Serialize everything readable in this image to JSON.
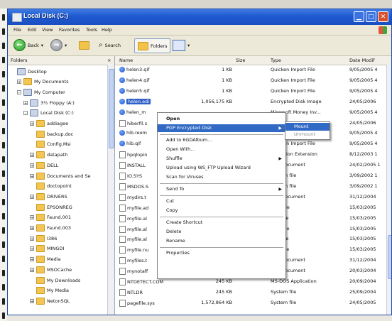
{
  "window": {
    "title": "Local Disk (C:)"
  },
  "menu": [
    "File",
    "Edit",
    "View",
    "Favorites",
    "Tools",
    "Help"
  ],
  "toolbar": {
    "back_label": "Back",
    "search_label": "Search",
    "folders_label": "Folders"
  },
  "folders_pane": {
    "header": "Folders",
    "close": "×",
    "tree": [
      {
        "label": "Desktop",
        "indent": 0,
        "pm": "",
        "kind": "desk"
      },
      {
        "label": "My Documents",
        "indent": 1,
        "pm": "+",
        "kind": "folder"
      },
      {
        "label": "My Computer",
        "indent": 1,
        "pm": "-",
        "kind": "comp"
      },
      {
        "label": "3½ Floppy (A:)",
        "indent": 2,
        "pm": "+",
        "kind": "drive"
      },
      {
        "label": "Local Disk (C:)",
        "indent": 2,
        "pm": "-",
        "kind": "drive"
      },
      {
        "label": "addiagee",
        "indent": 3,
        "pm": "+",
        "kind": "folder"
      },
      {
        "label": "backup.doc",
        "indent": 3,
        "pm": "",
        "kind": "folder"
      },
      {
        "label": "Config.Msi",
        "indent": 3,
        "pm": "",
        "kind": "folder"
      },
      {
        "label": "datapath",
        "indent": 3,
        "pm": "+",
        "kind": "folder"
      },
      {
        "label": "DELL",
        "indent": 3,
        "pm": "+",
        "kind": "folder"
      },
      {
        "label": "Documents and Se",
        "indent": 3,
        "pm": "+",
        "kind": "folder"
      },
      {
        "label": "doctopoint",
        "indent": 3,
        "pm": "",
        "kind": "folder"
      },
      {
        "label": "DRIVERS",
        "indent": 3,
        "pm": "+",
        "kind": "folder"
      },
      {
        "label": "EPSONREG",
        "indent": 3,
        "pm": "",
        "kind": "folder"
      },
      {
        "label": "Faund.001",
        "indent": 3,
        "pm": "+",
        "kind": "folder"
      },
      {
        "label": "Faund.003",
        "indent": 3,
        "pm": "+",
        "kind": "folder"
      },
      {
        "label": "I386",
        "indent": 3,
        "pm": "+",
        "kind": "folder"
      },
      {
        "label": "MINGDI",
        "indent": 3,
        "pm": "+",
        "kind": "folder"
      },
      {
        "label": "Media",
        "indent": 3,
        "pm": "+",
        "kind": "folder"
      },
      {
        "label": "MSOCache",
        "indent": 3,
        "pm": "+",
        "kind": "folder"
      },
      {
        "label": "My Downloads",
        "indent": 3,
        "pm": "",
        "kind": "folder"
      },
      {
        "label": "My Media",
        "indent": 3,
        "pm": "",
        "kind": "folder"
      },
      {
        "label": "NetonSQL",
        "indent": 3,
        "pm": "+",
        "kind": "folder"
      }
    ]
  },
  "files": {
    "headers": {
      "name": "Name",
      "size": "Size",
      "type": "Type",
      "date": "Date Modif"
    },
    "rows": [
      {
        "name": "helen3.qif",
        "size": "1 KB",
        "type": "Quicken Import File",
        "date": "9/05/2005 4",
        "icon": "qt",
        "sel": false
      },
      {
        "name": "helen4.qif",
        "size": "1 KB",
        "type": "Quicken Import File",
        "date": "9/05/2005 4",
        "icon": "qt",
        "sel": false
      },
      {
        "name": "helen5.qif",
        "size": "1 KB",
        "type": "Quicken Import File",
        "date": "9/05/2005 4",
        "icon": "qt",
        "sel": false
      },
      {
        "name": "helen.edi",
        "size": "1,056,175 KB",
        "type": "Encrypted Disk Image",
        "date": "24/05/2006",
        "icon": "qt",
        "sel": true
      },
      {
        "name": "helen_m",
        "size": "",
        "type": "Microsoft Money Inv...",
        "date": "9/05/2005 4",
        "icon": "qt",
        "sel": false
      },
      {
        "name": "hiberfil.s",
        "size": "",
        "type": "",
        "date": "24/05/2006",
        "icon": "doc",
        "sel": false
      },
      {
        "name": "hib.reom",
        "size": "",
        "type": "",
        "date": "9/05/2005 4",
        "icon": "qt",
        "sel": false
      },
      {
        "name": "hib.qif",
        "size": "",
        "type": "Quicken Import File",
        "date": "9/05/2005 4",
        "icon": "qt",
        "sel": false
      },
      {
        "name": "hpqlnpin",
        "size": "",
        "type": "pplication Extension",
        "date": "8/12/2003 1",
        "icon": "doc",
        "sel": false
      },
      {
        "name": "INSTALL",
        "size": "",
        "type": "Text Document",
        "date": "24/02/2005 1",
        "icon": "doc",
        "sel": false
      },
      {
        "name": "IO.SYS",
        "size": "",
        "type": "System file",
        "date": "3/09/2002 1",
        "icon": "doc",
        "sel": false
      },
      {
        "name": "MSDOS.S",
        "size": "",
        "type": "System file",
        "date": "3/09/2002 1",
        "icon": "doc",
        "sel": false
      },
      {
        "name": "mydirs.t",
        "size": "",
        "type": "Text Document",
        "date": "31/12/2004",
        "icon": "doc",
        "sel": false
      },
      {
        "name": "myfile.ad",
        "size": "",
        "type": "ADB File",
        "date": "15/03/2005",
        "icon": "doc",
        "sel": false
      },
      {
        "name": "myfile.al",
        "size": "",
        "type": "ALB File",
        "date": "15/03/2005",
        "icon": "doc",
        "sel": false
      },
      {
        "name": "myfile.al",
        "size": "",
        "type": "ALM File",
        "date": "15/03/2005",
        "icon": "doc",
        "sel": false
      },
      {
        "name": "myfile.al",
        "size": "",
        "type": "ALX File",
        "date": "15/03/2005",
        "icon": "doc",
        "sel": false
      },
      {
        "name": "myfile.nu",
        "size": "",
        "type": "NUF File",
        "date": "15/03/2005",
        "icon": "doc",
        "sel": false
      },
      {
        "name": "myfiles.t",
        "size": "",
        "type": "Text Document",
        "date": "31/12/2004",
        "icon": "doc",
        "sel": false
      },
      {
        "name": "mynotaff",
        "size": "",
        "type": "Text Document",
        "date": "20/03/2004",
        "icon": "doc",
        "sel": false
      },
      {
        "name": "NTDETECT.COM",
        "size": "245 KB",
        "type": "MS-DOS Application",
        "date": "20/09/2004",
        "icon": "doc",
        "sel": false
      },
      {
        "name": "NTLDR",
        "size": "245 KB",
        "type": "System file",
        "date": "25/09/2004",
        "icon": "doc",
        "sel": false
      },
      {
        "name": "pagefile.sys",
        "size": "1,572,864 KB",
        "type": "System file",
        "date": "24/05/2005",
        "icon": "doc",
        "sel": false
      }
    ]
  },
  "context_menu": {
    "items": [
      {
        "label": "Open",
        "bold": true,
        "sep_after": false,
        "submenu": false,
        "hl": false
      },
      {
        "label": "PGP Encrypted Disk",
        "bold": false,
        "sep_after": true,
        "submenu": true,
        "hl": true
      },
      {
        "label": "Add to 6GDAlbum...",
        "bold": false,
        "sep_after": false,
        "submenu": false,
        "hl": false
      },
      {
        "label": "Open With...",
        "bold": false,
        "sep_after": false,
        "submenu": false,
        "hl": false
      },
      {
        "label": "Shuffle",
        "bold": false,
        "sep_after": false,
        "submenu": true,
        "hl": false
      },
      {
        "label": "Upload using WS_FTP Upload Wizard",
        "bold": false,
        "sep_after": false,
        "submenu": false,
        "hl": false
      },
      {
        "label": "Scan for Viruses",
        "bold": false,
        "sep_after": true,
        "submenu": false,
        "hl": false
      },
      {
        "label": "Send To",
        "bold": false,
        "sep_after": true,
        "submenu": true,
        "hl": false
      },
      {
        "label": "Cut",
        "bold": false,
        "sep_after": false,
        "submenu": false,
        "hl": false
      },
      {
        "label": "Copy",
        "bold": false,
        "sep_after": true,
        "submenu": false,
        "hl": false
      },
      {
        "label": "Create Shortcut",
        "bold": false,
        "sep_after": false,
        "submenu": false,
        "hl": false
      },
      {
        "label": "Delete",
        "bold": false,
        "sep_after": false,
        "submenu": false,
        "hl": false
      },
      {
        "label": "Rename",
        "bold": false,
        "sep_after": true,
        "submenu": false,
        "hl": false
      },
      {
        "label": "Properties",
        "bold": false,
        "sep_after": false,
        "submenu": false,
        "hl": false
      }
    ]
  },
  "submenu": {
    "items": [
      {
        "label": "Mount",
        "hl": true
      },
      {
        "label": "Unmount",
        "hl": false
      }
    ]
  }
}
